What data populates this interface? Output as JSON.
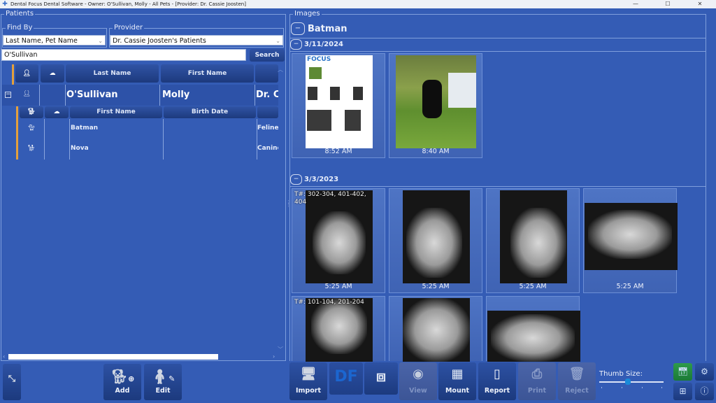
{
  "window": {
    "title": "Dental Focus Dental Software - Owner: O'Sullivan, Molly - All Pets - [Provider: Dr. Cassie Joosten]",
    "minimize": "—",
    "maximize": "☐",
    "close": "✕"
  },
  "patients": {
    "group_label": "Patients",
    "find_by": {
      "label": "Find By",
      "value": "Last Name, Pet Name"
    },
    "provider": {
      "label": "Provider",
      "value": "Dr. Cassie Joosten's Patients"
    },
    "search": {
      "value": "O'Sullivan",
      "button_label": "Search"
    },
    "owner_columns": [
      "Last Name",
      "First Name",
      ""
    ],
    "owner_icon_columns": [
      "person-icon",
      "cloud-icon"
    ],
    "owner_row": {
      "last_name": "O'Sullivan",
      "first_name": "Molly",
      "provider": "Dr. C"
    },
    "pet_columns": [
      "First Name",
      "Birth Date",
      ""
    ],
    "pet_icon_columns": [
      "dog-icon",
      "cloud-icon"
    ],
    "pets": [
      {
        "icon": "cat-icon",
        "first_name": "Batman",
        "birth_date": "",
        "species": "Feline"
      },
      {
        "icon": "dog-icon",
        "first_name": "Nova",
        "birth_date": "",
        "species": "Canine"
      }
    ],
    "toolbar": {
      "add_label": "Add",
      "edit_label": "Edit"
    }
  },
  "images": {
    "group_label": "Images",
    "patient_name": "Batman",
    "sessions": [
      {
        "date": "3/11/2024",
        "thumbnails": [
          {
            "kind": "report",
            "time": "8:52 AM",
            "report_brand": "FOCUS"
          },
          {
            "kind": "photo",
            "time": "8:40 AM"
          }
        ]
      },
      {
        "date": "3/3/2023",
        "thumbnails": [
          {
            "kind": "xray",
            "time": "5:25 AM",
            "teeth": "T#: 302-304, 401-402, 404"
          },
          {
            "kind": "xray",
            "time": "5:25 AM"
          },
          {
            "kind": "xray",
            "time": "5:25 AM"
          },
          {
            "kind": "xray",
            "time": "5:25 AM"
          },
          {
            "kind": "xray",
            "time": "",
            "teeth": "T#: 101-104, 201-204"
          },
          {
            "kind": "xray",
            "time": ""
          },
          {
            "kind": "xray",
            "time": ""
          }
        ]
      }
    ]
  },
  "toolbar": {
    "import_label": "Import",
    "view_label": "View",
    "mount_label": "Mount",
    "report_label": "Report",
    "print_label": "Print",
    "reject_label": "Reject",
    "thumb_size_label": "Thumb Size:",
    "thumb_size_fraction": 0.45
  },
  "colors": {
    "background": "#345cb5",
    "accent_orange": "#e4a03c",
    "slider_knob": "#1a8ad8",
    "calendar_green": "#2e9b4a"
  }
}
